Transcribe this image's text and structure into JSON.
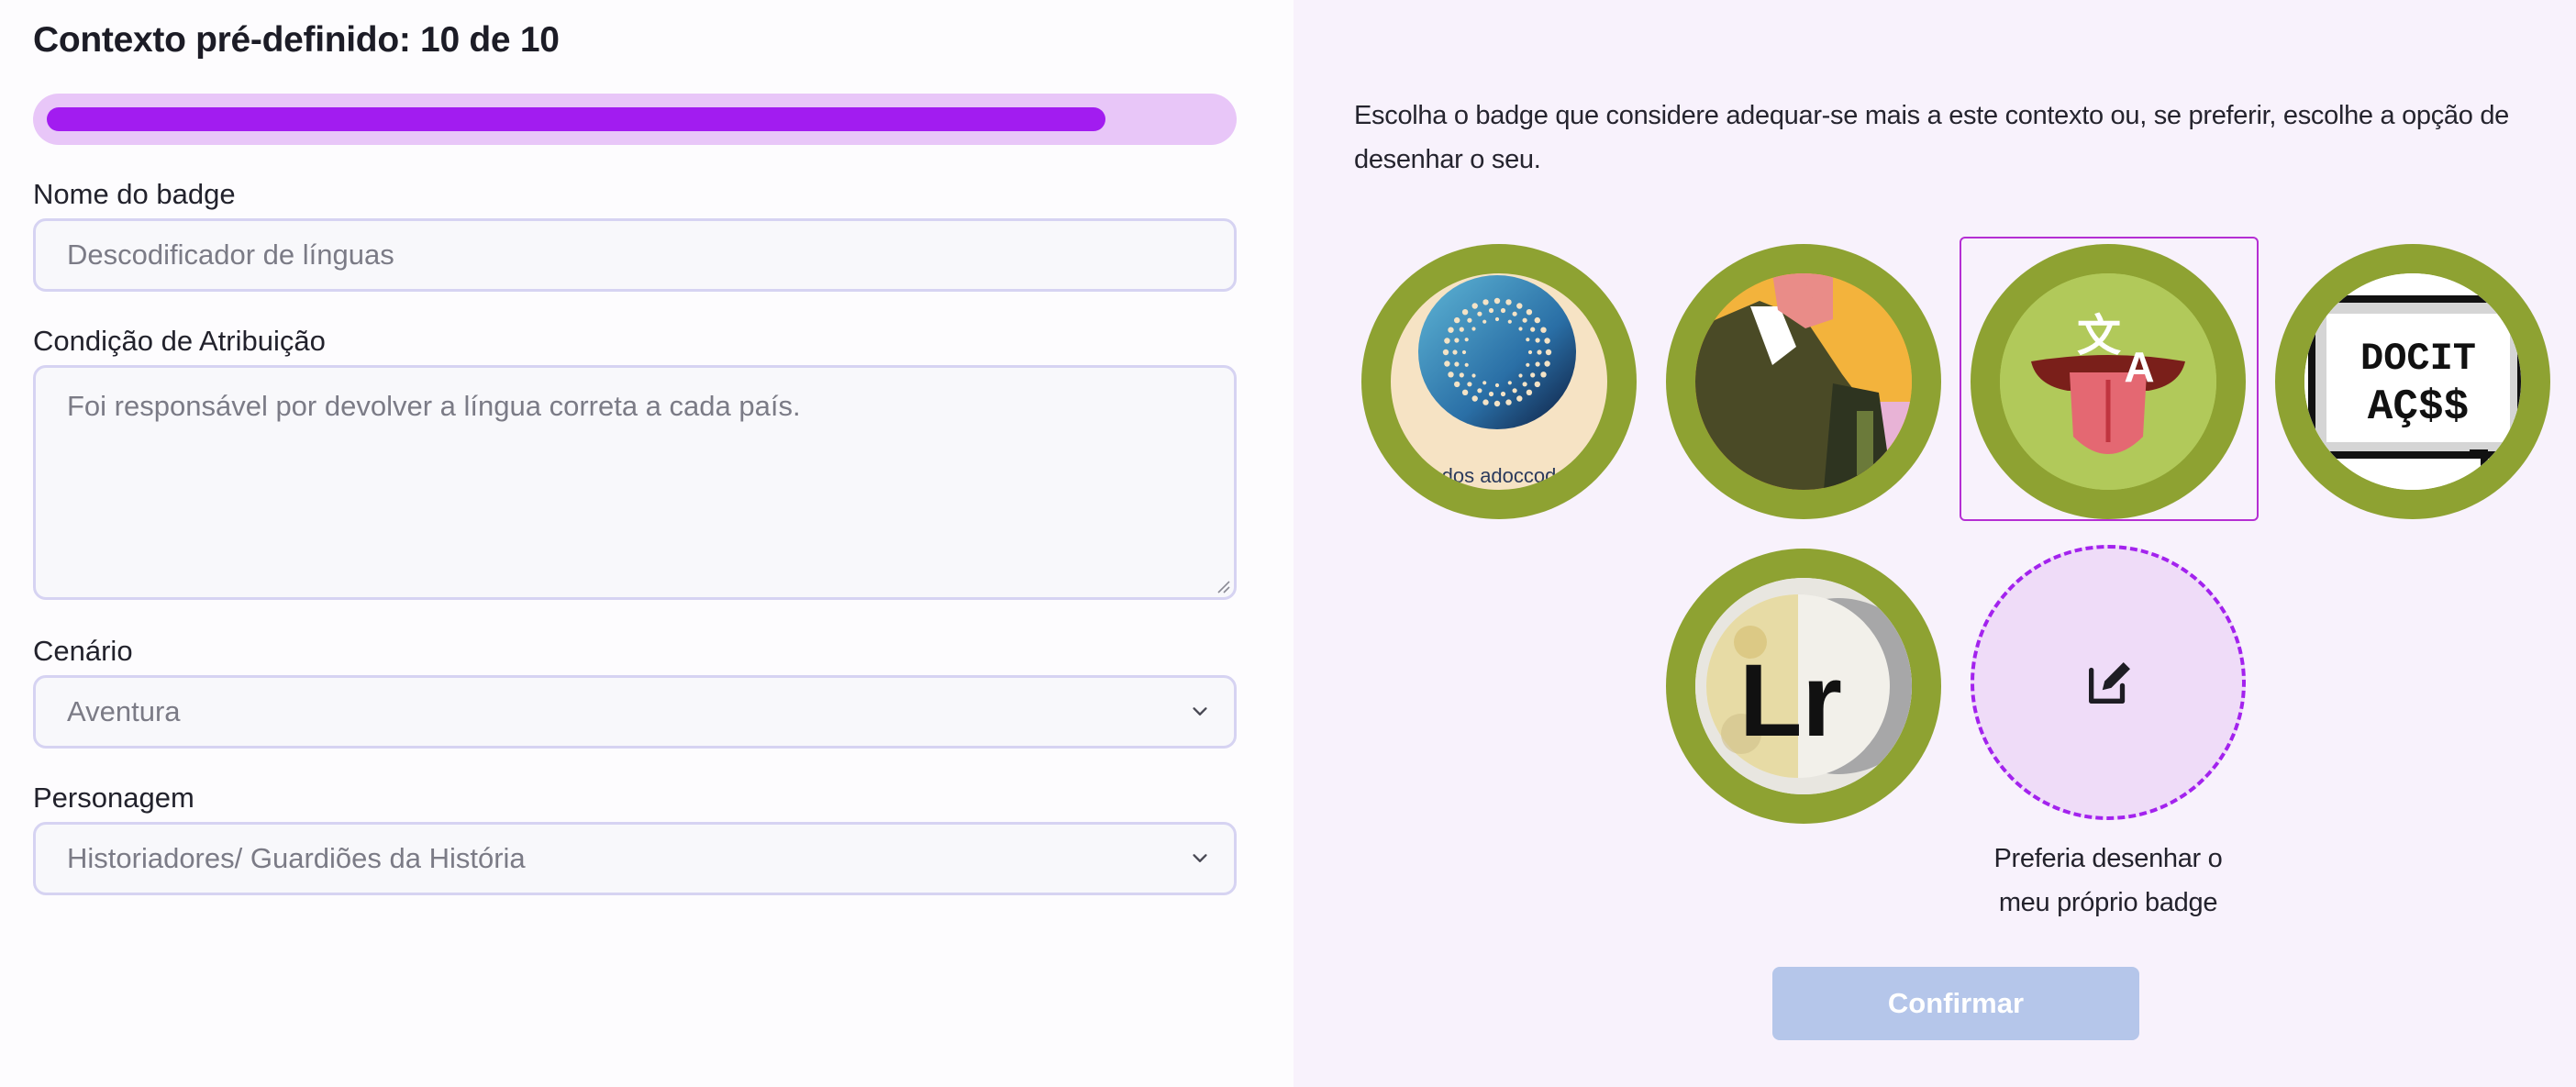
{
  "header": {
    "title": "Contexto pré-definido: 10 de 10"
  },
  "progress": {
    "value": 0.9
  },
  "form": {
    "badge_name": {
      "label": "Nome do badge",
      "value": "Descodificador de línguas"
    },
    "condition": {
      "label": "Condição de Atribuição",
      "value": "Foi responsável por devolver a língua correta a cada país."
    },
    "scenario": {
      "label": "Cenário",
      "value": "Aventura"
    },
    "character": {
      "label": "Personagem",
      "value": "Historiadores/ Guardiões da História"
    }
  },
  "panel": {
    "intro": "Escolha o badge que considere adequar-se mais a este contexto ou, se preferir, escolhe a opção de desenhar o seu.",
    "badges": [
      {
        "name": "dots-globe",
        "caption": "dos adoccod"
      },
      {
        "name": "figure-illustration"
      },
      {
        "name": "translate-tongue",
        "selected": true
      },
      {
        "name": "pixel-speech-bubble",
        "text": "DOCIT AÇ$$"
      },
      {
        "name": "lr-painting",
        "text": "Lr"
      }
    ],
    "draw_option": {
      "label": "Preferia desenhar o meu próprio badge",
      "icon": "edit-icon"
    },
    "confirm_label": "Confirmar"
  },
  "colors": {
    "accent": "#a21cf0",
    "progress_track": "#e8c6f8",
    "badge_ring": "#8ea232",
    "right_bg": "#f8f2fc",
    "confirm_disabled": "#b5c6ea"
  }
}
